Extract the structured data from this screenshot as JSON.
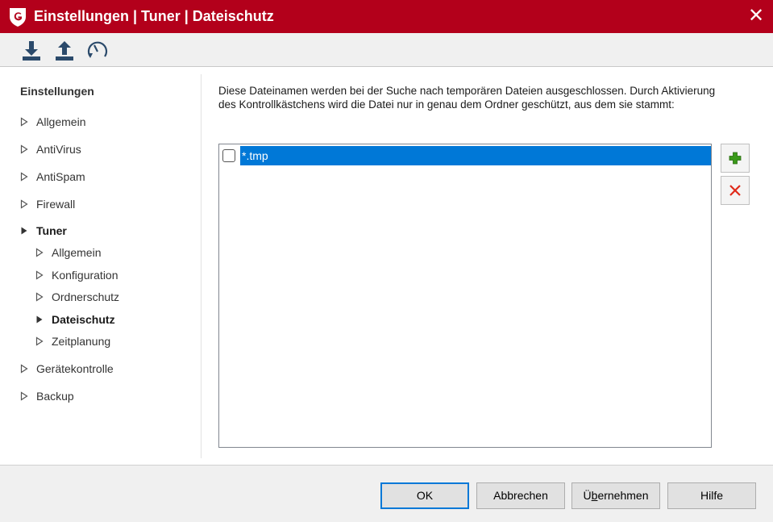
{
  "window": {
    "title": "Einstellungen | Tuner | Dateischutz",
    "close_glyph": "✕",
    "accent_color": "#b3001b"
  },
  "toolbar": {
    "buttons": [
      {
        "name": "import-icon",
        "tooltip": ""
      },
      {
        "name": "export-icon",
        "tooltip": ""
      },
      {
        "name": "restore-icon",
        "tooltip": ""
      }
    ]
  },
  "sidebar": {
    "heading": "Einstellungen",
    "items": [
      {
        "label": "Allgemein",
        "level": 0,
        "expanded": false,
        "active": false
      },
      {
        "label": "AntiVirus",
        "level": 0,
        "expanded": false,
        "active": false
      },
      {
        "label": "AntiSpam",
        "level": 0,
        "expanded": false,
        "active": false
      },
      {
        "label": "Firewall",
        "level": 0,
        "expanded": false,
        "active": false
      },
      {
        "label": "Tuner",
        "level": 0,
        "expanded": true,
        "active": true
      },
      {
        "label": "Allgemein",
        "level": 1,
        "expanded": false,
        "active": false
      },
      {
        "label": "Konfiguration",
        "level": 1,
        "expanded": false,
        "active": false
      },
      {
        "label": "Ordnerschutz",
        "level": 1,
        "expanded": false,
        "active": false
      },
      {
        "label": "Dateischutz",
        "level": 1,
        "expanded": false,
        "active": true
      },
      {
        "label": "Zeitplanung",
        "level": 1,
        "expanded": false,
        "active": false
      },
      {
        "label": "Gerätekontrolle",
        "level": 0,
        "expanded": false,
        "active": false
      },
      {
        "label": "Backup",
        "level": 0,
        "expanded": false,
        "active": false
      }
    ]
  },
  "main": {
    "description": "Diese Dateinamen werden bei der Suche nach temporären Dateien ausgeschlossen. Durch Aktivierung des Kontrollkästchens wird die Datei nur in genau dem Ordner geschützt, aus dem sie stammt:",
    "list": [
      {
        "label": "*.tmp",
        "checked": false,
        "selected": true
      }
    ],
    "add_icon": "plus-icon",
    "remove_icon": "delete-icon",
    "selection_color": "#0078d7"
  },
  "footer": {
    "ok": "OK",
    "cancel": "Abbrechen",
    "apply_prefix": "Ü",
    "apply_mnemonic": "b",
    "apply_suffix": "ernehmen",
    "help": "Hilfe"
  }
}
